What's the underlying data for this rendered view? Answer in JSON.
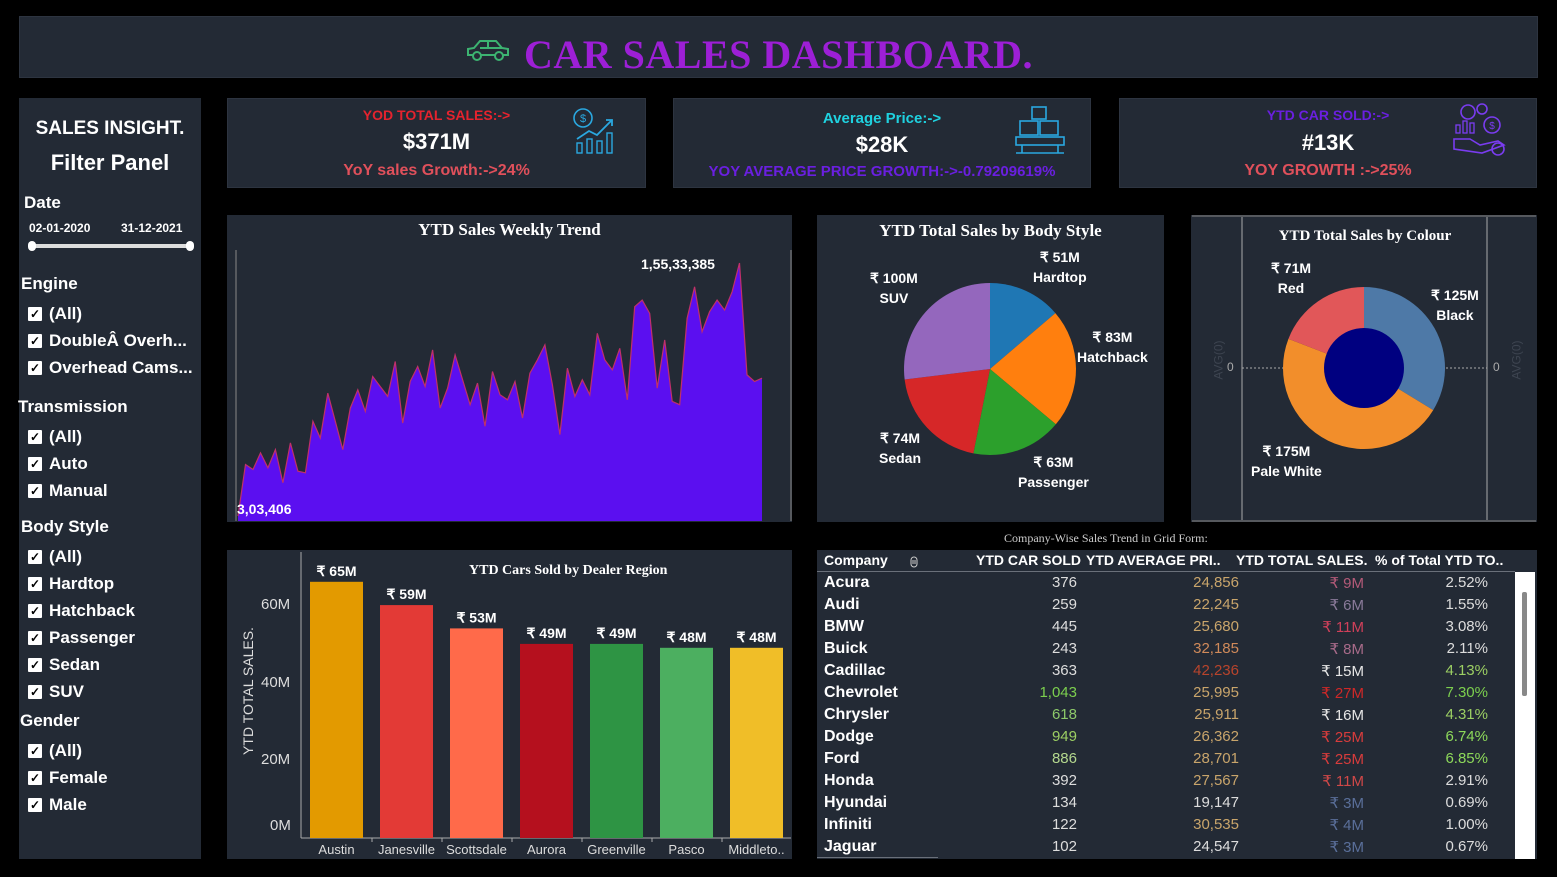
{
  "header": {
    "title": "CAR SALES DASHBOARD.",
    "icon": "car-icon",
    "title_color": "#9d1fd6"
  },
  "filter": {
    "title1": "SALES INSIGHT.",
    "title2": "Filter Panel",
    "date": {
      "label": "Date",
      "start": "02-01-2020",
      "end": "31-12-2021"
    },
    "engine": {
      "label": "Engine",
      "options": [
        "(All)",
        "DoubleÂ Overh...",
        "Overhead Cams..."
      ]
    },
    "transmission": {
      "label": "Transmission",
      "options": [
        "(All)",
        "Auto",
        "Manual"
      ]
    },
    "body_style": {
      "label": "Body Style",
      "options": [
        "(All)",
        "Hardtop",
        "Hatchback",
        "Passenger",
        "Sedan",
        "SUV"
      ]
    },
    "gender": {
      "label": "Gender",
      "options": [
        "(All)",
        "Female",
        "Male"
      ]
    }
  },
  "kpis": [
    {
      "label": "YOD TOTAL SALES:->",
      "value": "$371M",
      "sub": "YoY sales Growth:->24%",
      "label_color": "#e5232e",
      "sub_color": "#e0505b",
      "icon": "sales-growth-icon"
    },
    {
      "label": "Average Price:->",
      "value": "$28K",
      "sub": "YOY AVERAGE PRICE GROWTH:->-0.79209619%",
      "label_color": "#1fd2e0",
      "sub_color": "#6a1fe0",
      "icon": "boxes-icon"
    },
    {
      "label": "YTD CAR SOLD:->",
      "value": "#13K",
      "sub": "YOY  GROWTH :->25%",
      "label_color": "#6a1fe0",
      "sub_color": "#e0505b",
      "icon": "investment-icon"
    }
  ],
  "weekly_trend": {
    "title": "YTD Sales Weekly Trend",
    "max_label": "1,55,33,385",
    "min_label": "3,03,406",
    "fill_color": "#5b0ff0"
  },
  "body_style_pie": {
    "title": "YTD Total Sales by Body Style",
    "slices": [
      {
        "name": "Hardtop",
        "value_label": "₹ 51M",
        "color": "#1f77b4"
      },
      {
        "name": "Hatchback",
        "value_label": "₹ 83M",
        "color": "#ff7f0e"
      },
      {
        "name": "Passenger",
        "value_label": "₹ 63M",
        "color": "#2ca02c"
      },
      {
        "name": "Sedan",
        "value_label": "₹ 74M",
        "color": "#d62728"
      },
      {
        "name": "SUV",
        "value_label": "₹ 100M",
        "color": "#9467bd"
      }
    ]
  },
  "colour_donut": {
    "title": "YTD Total Sales by Colour",
    "axis_label": "AVG(0)",
    "zero": "0",
    "slices": [
      {
        "name": "Black",
        "value_label": "₹ 125M",
        "color": "#4e79a7"
      },
      {
        "name": "Pale White",
        "value_label": "₹ 175M",
        "color": "#f28e2b"
      },
      {
        "name": "Red",
        "value_label": "₹ 71M",
        "color": "#e15759"
      }
    ],
    "hole_color": "#000080"
  },
  "dealer_region": {
    "title": "YTD Cars Sold by Dealer Region",
    "ylabel": "YTD TOTAL SALES.",
    "yticks": [
      "60M",
      "40M",
      "20M",
      "0M"
    ]
  },
  "grid": {
    "title": "Company-Wise Sales Trend in Grid Form:",
    "headers": [
      "Company",
      "YTD CAR SOLD",
      "YTD AVERAGE PRI..",
      "YTD TOTAL SALES.",
      "% of Total YTD TO.."
    ],
    "rows": [
      {
        "company": "Acura",
        "sold": "376",
        "avg": "24,856",
        "total": "₹ 9M",
        "pct": "2.52%"
      },
      {
        "company": "Audi",
        "sold": "259",
        "avg": "22,245",
        "total": "₹ 6M",
        "pct": "1.55%"
      },
      {
        "company": "BMW",
        "sold": "445",
        "avg": "25,680",
        "total": "₹ 11M",
        "pct": "3.08%"
      },
      {
        "company": "Buick",
        "sold": "243",
        "avg": "32,185",
        "total": "₹ 8M",
        "pct": "2.11%"
      },
      {
        "company": "Cadillac",
        "sold": "363",
        "avg": "42,236",
        "total": "₹ 15M",
        "pct": "4.13%"
      },
      {
        "company": "Chevrolet",
        "sold": "1,043",
        "avg": "25,995",
        "total": "₹ 27M",
        "pct": "7.30%"
      },
      {
        "company": "Chrysler",
        "sold": "618",
        "avg": "25,911",
        "total": "₹ 16M",
        "pct": "4.31%"
      },
      {
        "company": "Dodge",
        "sold": "949",
        "avg": "26,362",
        "total": "₹ 25M",
        "pct": "6.74%"
      },
      {
        "company": "Ford",
        "sold": "886",
        "avg": "28,701",
        "total": "₹ 25M",
        "pct": "6.85%"
      },
      {
        "company": "Honda",
        "sold": "392",
        "avg": "27,567",
        "total": "₹ 11M",
        "pct": "2.91%"
      },
      {
        "company": "Hyundai",
        "sold": "134",
        "avg": "19,147",
        "total": "₹ 3M",
        "pct": "0.69%"
      },
      {
        "company": "Infiniti",
        "sold": "122",
        "avg": "30,535",
        "total": "₹ 4M",
        "pct": "1.00%"
      },
      {
        "company": "Jaguar",
        "sold": "102",
        "avg": "24,547",
        "total": "₹ 3M",
        "pct": "0.67%"
      }
    ],
    "colors": {
      "sold": [
        "#ddd",
        "#ddd",
        "#ddd",
        "#ddd",
        "#ddd",
        "#7ccf4e",
        "#8dc96a",
        "#9ccf63",
        "#b4d88e",
        "#ddd",
        "#ddd",
        "#ddd",
        "#ddd"
      ],
      "avg": [
        "#c9a56b",
        "#c9a56b",
        "#c9a56b",
        "#d08a5a",
        "#b8442c",
        "#c9a56b",
        "#c9a56b",
        "#c9a56b",
        "#c9a56b",
        "#c9a56b",
        "#ddd",
        "#c9a56b",
        "#ddd"
      ],
      "total": [
        "#b35a78",
        "#8a7a9a",
        "#d0405a",
        "#a86b8a",
        "#e6e6e6",
        "#d02828",
        "#e6e6e6",
        "#d83c3c",
        "#d83c3c",
        "#d04848",
        "#5a6f9a",
        "#5a6f9a",
        "#5a6f9a"
      ],
      "pct": [
        "#ddd",
        "#ddd",
        "#ddd",
        "#ddd",
        "#9ccf63",
        "#7ccf4e",
        "#9ccf63",
        "#8dd95a",
        "#8dd95a",
        "#ddd",
        "#ddd",
        "#ddd",
        "#ddd"
      ]
    }
  },
  "chart_data": [
    {
      "type": "area",
      "title": "YTD Sales Weekly Trend",
      "xlabel": "",
      "ylabel": "",
      "values": [
        303406,
        3400000,
        3100000,
        4100000,
        3200000,
        4300000,
        2300000,
        4700000,
        3000000,
        2900000,
        6000000,
        5000000,
        7700000,
        6000000,
        4300000,
        6800000,
        7900000,
        6600000,
        8700000,
        8100000,
        7500000,
        9600000,
        5900000,
        8400000,
        9300000,
        8100000,
        10300000,
        6800000,
        8000000,
        10000000,
        8500000,
        7000000,
        8300000,
        5700000,
        9000000,
        7600000,
        7300000,
        8400000,
        6200000,
        8900000,
        9700000,
        10600000,
        8200000,
        5200000,
        9200000,
        7500000,
        8500000,
        7600000,
        11300000,
        9700000,
        9100000,
        10400000,
        7300000,
        12900000,
        13300000,
        12500000,
        8000000,
        10900000,
        7200000,
        7000000,
        12200000,
        14100000,
        11400000,
        12600000,
        13300000,
        12700000,
        13800000,
        15533385,
        8800000,
        8400000,
        8600000
      ]
    },
    {
      "type": "pie",
      "title": "YTD Total Sales by Body Style",
      "categories": [
        "Hardtop",
        "Hatchback",
        "Passenger",
        "Sedan",
        "SUV"
      ],
      "values": [
        51,
        83,
        63,
        74,
        100
      ],
      "unit": "₹ M"
    },
    {
      "type": "pie",
      "title": "YTD Total Sales by Colour",
      "categories": [
        "Black",
        "Pale White",
        "Red"
      ],
      "values": [
        125,
        175,
        71
      ],
      "unit": "₹ M"
    },
    {
      "type": "bar",
      "title": "YTD Cars Sold by Dealer Region",
      "categories": [
        "Austin",
        "Janesville",
        "Scottsdale",
        "Aurora",
        "Greenville",
        "Pasco",
        "Middleto.."
      ],
      "values": [
        65,
        59,
        53,
        49,
        49,
        48,
        48
      ],
      "value_labels": [
        "₹ 65M",
        "₹ 59M",
        "₹ 53M",
        "₹ 49M",
        "₹ 49M",
        "₹ 48M",
        "₹ 48M"
      ],
      "colors": [
        "#e39a00",
        "#e33a36",
        "#ff6a4a",
        "#b5101e",
        "#2e9444",
        "#4caf60",
        "#f0be28"
      ],
      "ylabel": "YTD TOTAL SALES.",
      "ylim": [
        0,
        70
      ]
    }
  ]
}
